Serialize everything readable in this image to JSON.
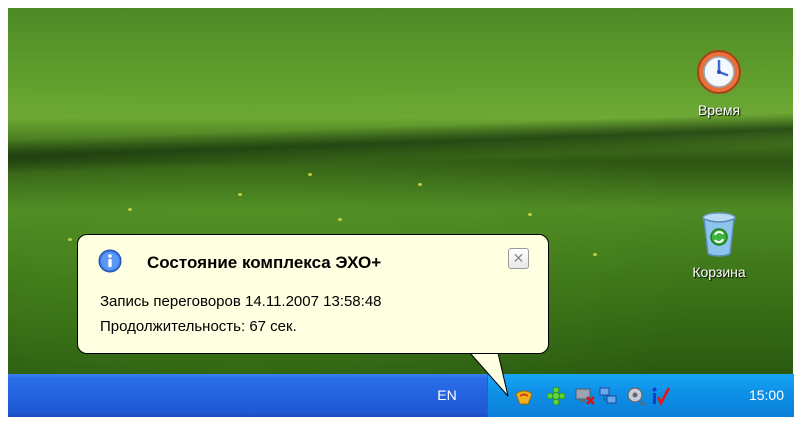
{
  "desktop": {
    "icons": [
      {
        "label": "Время",
        "icon": "clock-icon"
      },
      {
        "label": "Корзина",
        "icon": "recycle-bin-icon"
      }
    ]
  },
  "balloon": {
    "title": "Состояние комплекса ЭХО+",
    "line1": "Запись переговоров 14.11.2007 13:58:48",
    "line2": "Продолжительность: 67 сек.",
    "close_label": "✕",
    "icon": "info-icon"
  },
  "taskbar": {
    "language": "EN",
    "clock": "15:00",
    "tray_icons": [
      "echo-plus-tray-icon",
      "green-gear-tray-icon",
      "network-disconnected-tray-icon",
      "network-computers-tray-icon",
      "audio-tray-icon",
      "checkmark-i-tray-icon"
    ]
  },
  "colors": {
    "taskbar_blue": "#2462df",
    "tray_blue": "#0d8fe6",
    "balloon_bg": "#ffffe1"
  }
}
